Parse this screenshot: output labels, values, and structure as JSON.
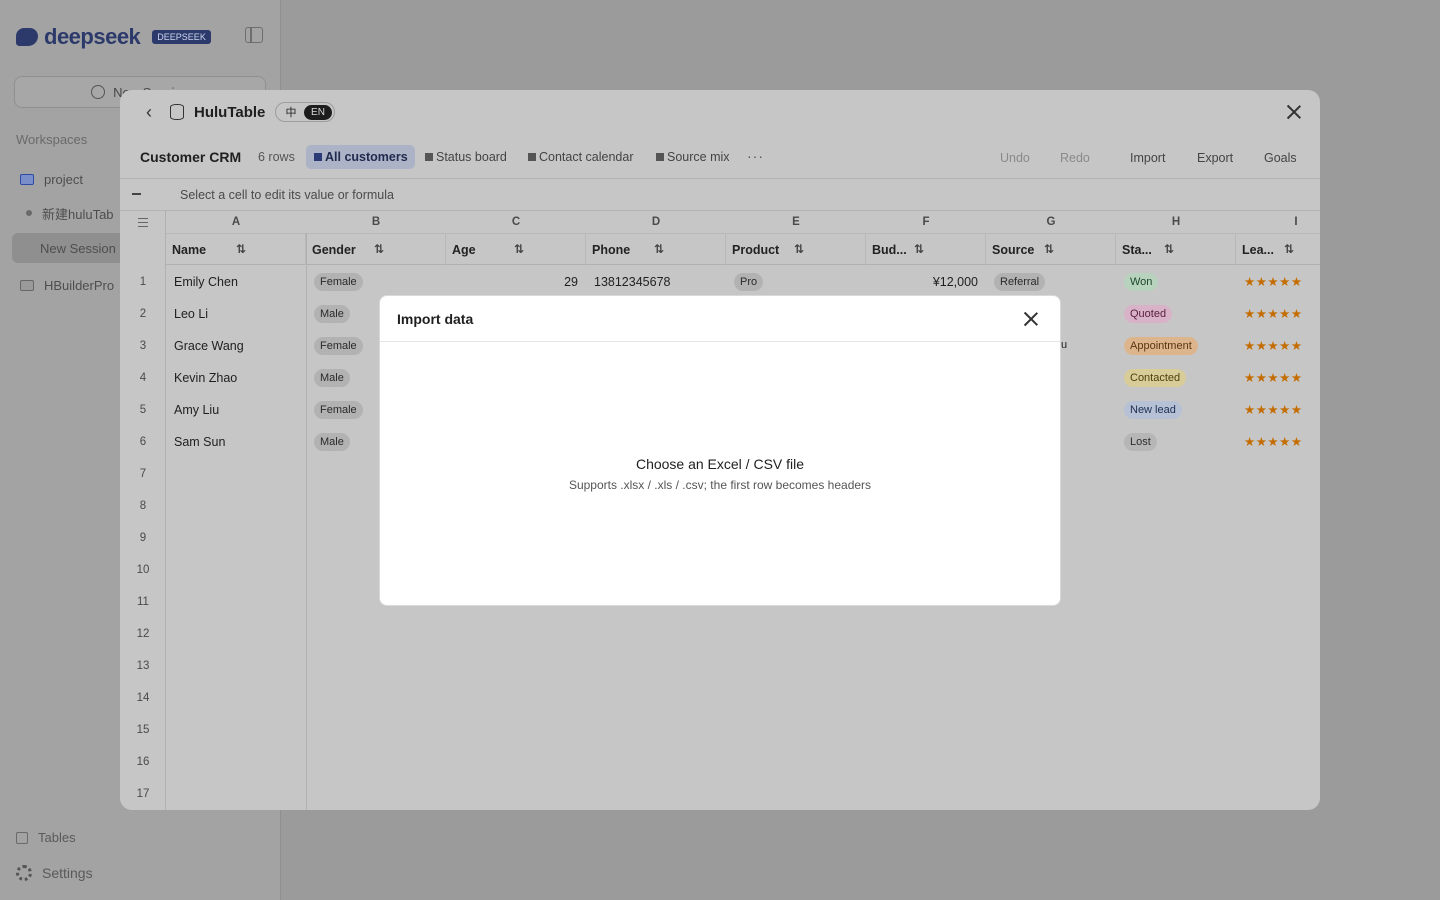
{
  "colors": {
    "star": "#c46c00",
    "active_tab_bg": "#adb3c6"
  },
  "sidebar": {
    "brand": "deepseek",
    "brand_badge": "DEEPSEEK",
    "new_session": "New Session",
    "workspaces_label": "Workspaces",
    "items": [
      {
        "label": "project",
        "icon": "folder-icon"
      },
      {
        "label": "新建huluTab",
        "icon": "dot-icon"
      },
      {
        "label": "New Session",
        "icon": "none"
      },
      {
        "label": "HBuilderPro",
        "icon": "folder-icon"
      }
    ],
    "tables_label": "Tables",
    "settings_label": "Settings"
  },
  "window": {
    "title": "HuluTable",
    "lang_zh": "中",
    "lang_en": "EN"
  },
  "toolbar": {
    "doc_title": "Customer CRM",
    "row_count": "6 rows",
    "views": [
      "All customers",
      "Status board",
      "Contact calendar",
      "Source mix"
    ],
    "more": "···",
    "undo": "Undo",
    "redo": "Redo",
    "import": "Import",
    "export": "Export",
    "goals": "Goals"
  },
  "formula_hint": "Select a cell to edit its value or formula",
  "grid": {
    "column_letters": [
      "A",
      "B",
      "C",
      "D",
      "E",
      "F",
      "G",
      "H",
      "I"
    ],
    "columns": [
      "Name",
      "Gender",
      "Age",
      "Phone",
      "Product",
      "Bud...",
      "Source",
      "Sta...",
      "Lea..."
    ],
    "row_numbers": [
      "1",
      "2",
      "3",
      "4",
      "5",
      "6",
      "7",
      "8",
      "9",
      "10",
      "11",
      "12",
      "13",
      "14",
      "15",
      "16",
      "17"
    ],
    "rows": [
      {
        "name": "Emily Chen",
        "gender": "Female",
        "age": "29",
        "phone": "13812345678",
        "product": "Pro",
        "budget": "¥12,000",
        "source": "Referral",
        "status": "Won",
        "stars": "★★★★★"
      },
      {
        "name": "Leo Li",
        "gender": "Male",
        "status": "Quoted",
        "stars": "★★★★★"
      },
      {
        "name": "Grace Wang",
        "gender": "Female",
        "source_fragment": "u",
        "status": "Appointment",
        "stars": "★★★★★"
      },
      {
        "name": "Kevin Zhao",
        "gender": "Male",
        "status": "Contacted",
        "stars": "★★★★★"
      },
      {
        "name": "Amy Liu",
        "gender": "Female",
        "status": "New lead",
        "stars": "★★★★★"
      },
      {
        "name": "Sam Sun",
        "gender": "Male",
        "status": "Lost",
        "stars": "★★★★★"
      }
    ],
    "status_colors": {
      "Won": "#b7d2bd",
      "Quoted": "#d8b2c6",
      "Appointment": "#dcb58c",
      "Contacted": "#d8cc98",
      "New lead": "#b6c1d6",
      "Lost": "#b6b6b6"
    }
  },
  "modal": {
    "title": "Import data",
    "drop_title": "Choose an Excel / CSV file",
    "drop_subtitle": "Supports .xlsx / .xls / .csv; the first row becomes headers"
  }
}
